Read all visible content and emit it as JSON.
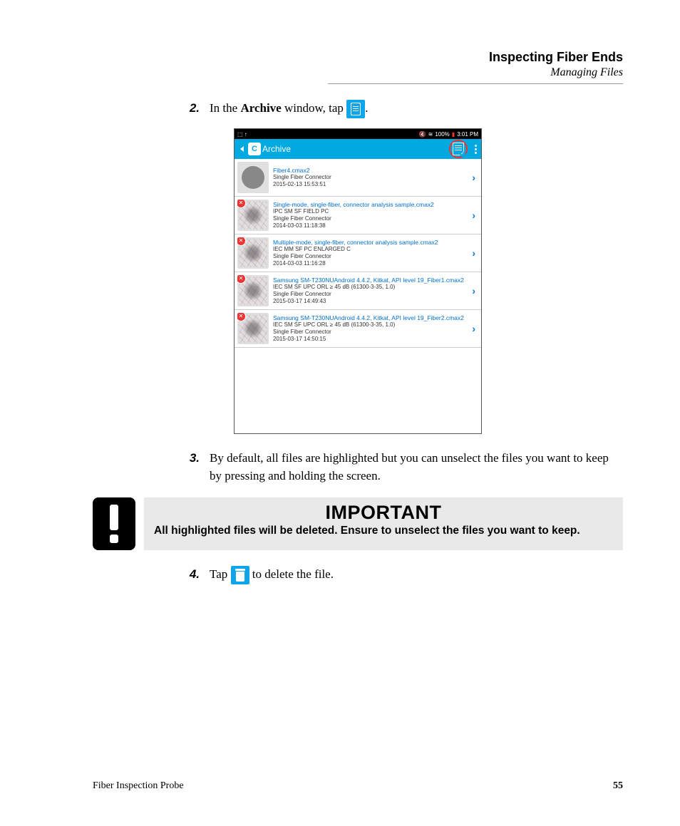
{
  "header": {
    "title": "Inspecting Fiber Ends",
    "subtitle": "Managing Files"
  },
  "steps": {
    "s2_num": "2.",
    "s2_a": "In the ",
    "s2_bold": "Archive",
    "s2_b": " window, tap ",
    "s2_end": ".",
    "s3_num": "3.",
    "s3": "By default, all files are highlighted but you can unselect the files you want to keep by pressing and holding the screen.",
    "s4_num": "4.",
    "s4_a": "Tap ",
    "s4_b": " to delete the file."
  },
  "important": {
    "title": "IMPORTANT",
    "body": "All highlighted files will be deleted. Ensure to unselect the files you want to keep."
  },
  "screenshot": {
    "status": {
      "left": "⬚ ↑",
      "wifi": "≋",
      "signal": "📶",
      "pct": "100%",
      "batt": "▮",
      "time": "3:01 PM"
    },
    "appbar": {
      "title": "Archive"
    },
    "files": [
      {
        "name": "Fiber4.cmax2",
        "l1": "",
        "l2": "Single Fiber Connector",
        "l3": "2015-02-13 15:53:51",
        "thumb": "gray",
        "badge": false
      },
      {
        "name": "Single-mode, single-fiber, connector analysis sample.cmax2",
        "l1": "IPC SM SF FIELD PC",
        "l2": "Single Fiber Connector",
        "l3": "2014-03-03 11:18:38",
        "thumb": "fiber",
        "badge": true
      },
      {
        "name": "Multiple-mode, single-fiber, connector analysis sample.cmax2",
        "l1": "IEC MM SF PC ENLARGED C",
        "l2": "Single Fiber Connector",
        "l3": "2014-03-03 11:16:28",
        "thumb": "fiber",
        "badge": true
      },
      {
        "name": "Samsung SM-T230NUAndroid 4.4.2, Kitkat, API level 19_Fiber1.cmax2",
        "l1": "IEC SM SF UPC ORL ≥ 45 dB (61300-3-35, 1.0)",
        "l2": "Single Fiber Connector",
        "l3": "2015-03-17 14:49:43",
        "thumb": "fiber",
        "badge": true
      },
      {
        "name": "Samsung SM-T230NUAndroid 4.4.2, Kitkat, API level 19_Fiber2.cmax2",
        "l1": "IEC SM SF UPC ORL ≥ 45 dB (61300-3-35, 1.0)",
        "l2": "Single Fiber Connector",
        "l3": "2015-03-17 14:50:15",
        "thumb": "fiber",
        "badge": true
      }
    ]
  },
  "footer": {
    "left": "Fiber Inspection Probe",
    "page": "55"
  }
}
